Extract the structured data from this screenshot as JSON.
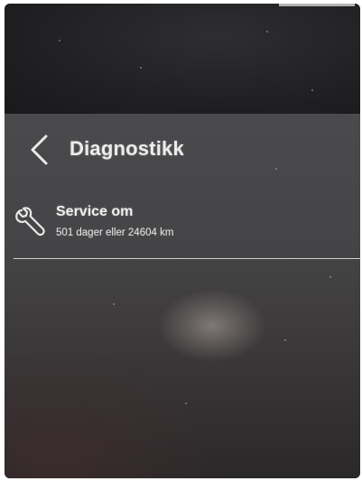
{
  "header": {
    "title": "Diagnostikk",
    "back_icon": "chevron-left-icon"
  },
  "service_item": {
    "icon": "wrench-icon",
    "title": "Service om",
    "subtitle": "501 dager eller 24604 km"
  },
  "colors": {
    "text": "#ececec",
    "screen_background": "#4a4a4c",
    "bezel": "#1e1e20",
    "divider": "#cfcfcf"
  }
}
